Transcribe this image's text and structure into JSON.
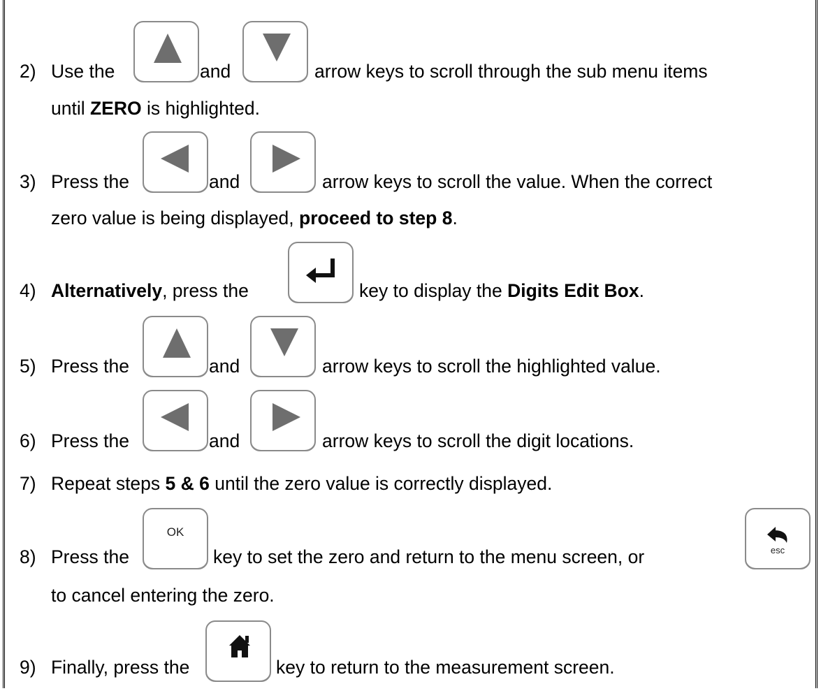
{
  "steps": [
    {
      "num": "2)",
      "a": "Use the",
      "b": "and",
      "c": "arrow keys to scroll through the sub menu items",
      "cont_pre": "until ",
      "cont_bold": "ZERO",
      "cont_post": " is highlighted."
    },
    {
      "num": "3)",
      "a": "Press the",
      "b": "and",
      "c": "arrow keys to scroll the value.  When the correct",
      "cont_pre": "zero value is being displayed, ",
      "cont_bold": "proceed to step 8",
      "cont_post": "."
    },
    {
      "num": "4)",
      "a_bold": "Alternatively",
      "a": ", press the",
      "c": "key to display the ",
      "c_bold": "Digits Edit Box",
      "c_post": "."
    },
    {
      "num": "5)",
      "a": "Press the",
      "b": "and",
      "c": "arrow keys to scroll the highlighted value."
    },
    {
      "num": "6)",
      "a": "Press the",
      "b": "and",
      "c": "arrow keys to scroll the digit locations."
    },
    {
      "num": "7)",
      "a": " Repeat steps ",
      "a_bold": "5 & 6",
      "c": " until the zero value is correctly displayed."
    },
    {
      "num": "8)",
      "a": "Press the",
      "c": "key to set the zero and return to the menu screen, or",
      "cont_pre": "to cancel entering the zero."
    },
    {
      "num": "9)",
      "a": "Finally, press the",
      "c": "key to return to the measurement screen."
    }
  ],
  "keys": {
    "ok_label": "OK",
    "esc_label": "esc"
  },
  "icons": [
    "up-arrow-icon",
    "down-arrow-icon",
    "left-arrow-icon",
    "right-arrow-icon",
    "enter-icon",
    "home-icon",
    "back-arrow-icon"
  ]
}
